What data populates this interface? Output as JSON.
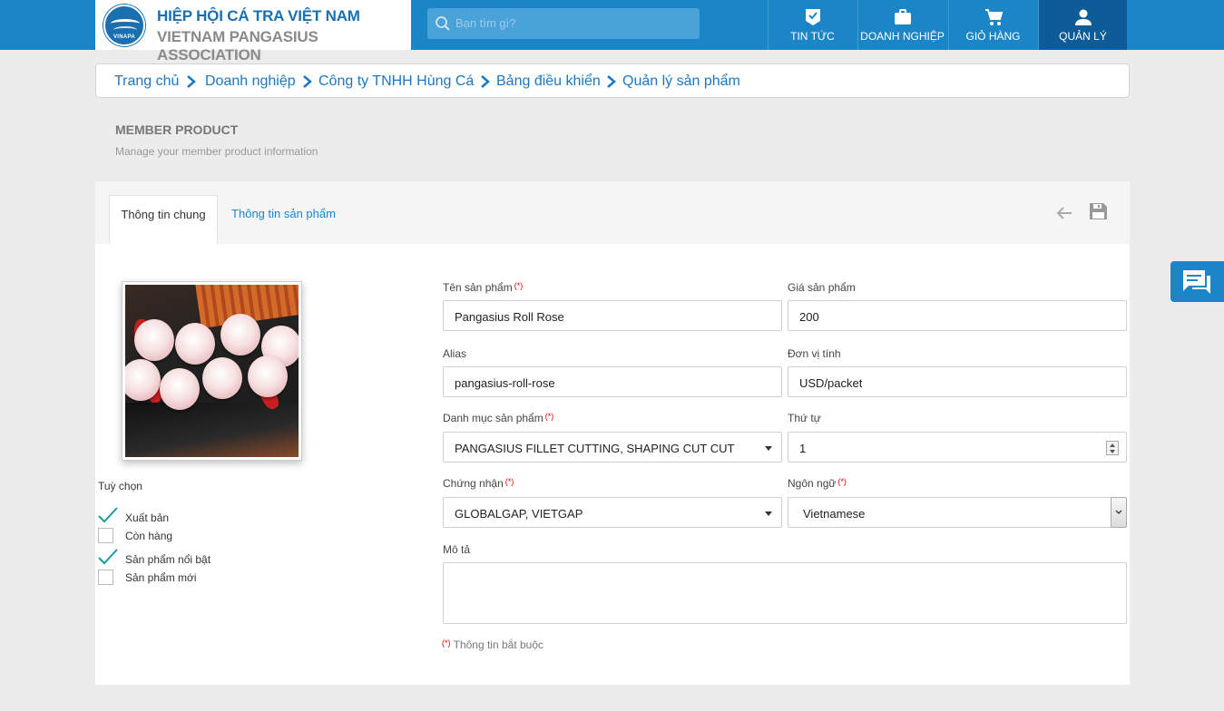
{
  "header": {
    "logo": {
      "emblem_text": "VINAPA",
      "title_vi": "HIỆP HỘI CÁ TRA VIỆT NAM",
      "title_en": "VIETNAM PANGASIUS ASSOCIATION"
    },
    "search": {
      "placeholder": "Bạn tìm gì?"
    },
    "nav": [
      {
        "label": "TIN TỨC",
        "icon": "news-check-icon"
      },
      {
        "label": "DOANH NGHIỆP",
        "icon": "briefcase-icon"
      },
      {
        "label": "GIỎ HÀNG",
        "icon": "cart-icon"
      },
      {
        "label": "QUẢN LÝ",
        "icon": "user-icon",
        "active": true
      }
    ]
  },
  "breadcrumb": [
    "Trang chủ",
    "Doanh nghiệp",
    "Công ty TNHH Hùng Cá",
    "Bảng điều khiển",
    "Quản lý sản phẩm"
  ],
  "page": {
    "title": "MEMBER PRODUCT",
    "subtitle": "Manage your member product information"
  },
  "tabs": [
    {
      "label": "Thông tin chung",
      "active": true
    },
    {
      "label": "Thông tin sản phẩm",
      "active": false
    }
  ],
  "options": {
    "title": "Tuỳ chọn",
    "items": [
      {
        "label": "Xuất bản",
        "checked": true
      },
      {
        "label": "Còn hàng",
        "checked": false
      },
      {
        "label": "Sản phẩm nổi bật",
        "checked": true
      },
      {
        "label": "Sản phẩm mới",
        "checked": false
      }
    ]
  },
  "form": {
    "name": {
      "label": "Tên sản phẩm",
      "required_mark": "(*)",
      "value": "Pangasius Roll Rose"
    },
    "price": {
      "label": "Giá sản phẩm",
      "value": "200"
    },
    "alias": {
      "label": "Alias",
      "value": "pangasius-roll-rose"
    },
    "unit": {
      "label": "Đơn vị tính",
      "value": "USD/packet"
    },
    "category": {
      "label": "Danh mục sản phẩm",
      "required_mark": "(*)",
      "value": "PANGASIUS FILLET CUTTING, SHAPING CUT CUT"
    },
    "order": {
      "label": "Thứ tự",
      "value": "1"
    },
    "certification": {
      "label": "Chứng nhận",
      "required_mark": "(*)",
      "value": "GLOBALGAP, VIETGAP"
    },
    "language": {
      "label": "Ngôn ngữ",
      "required_mark": "(*)",
      "value": "Vietnamese"
    },
    "description": {
      "label": "Mô tả",
      "value": ""
    },
    "required_note": {
      "mark": "(*)",
      "text": " Thông tin bắt buộc"
    }
  },
  "colors": {
    "brand_blue": "#1a86c8",
    "active_nav": "#0d5c97",
    "check_teal": "#1a9a9a",
    "required_red": "#dd0000"
  }
}
